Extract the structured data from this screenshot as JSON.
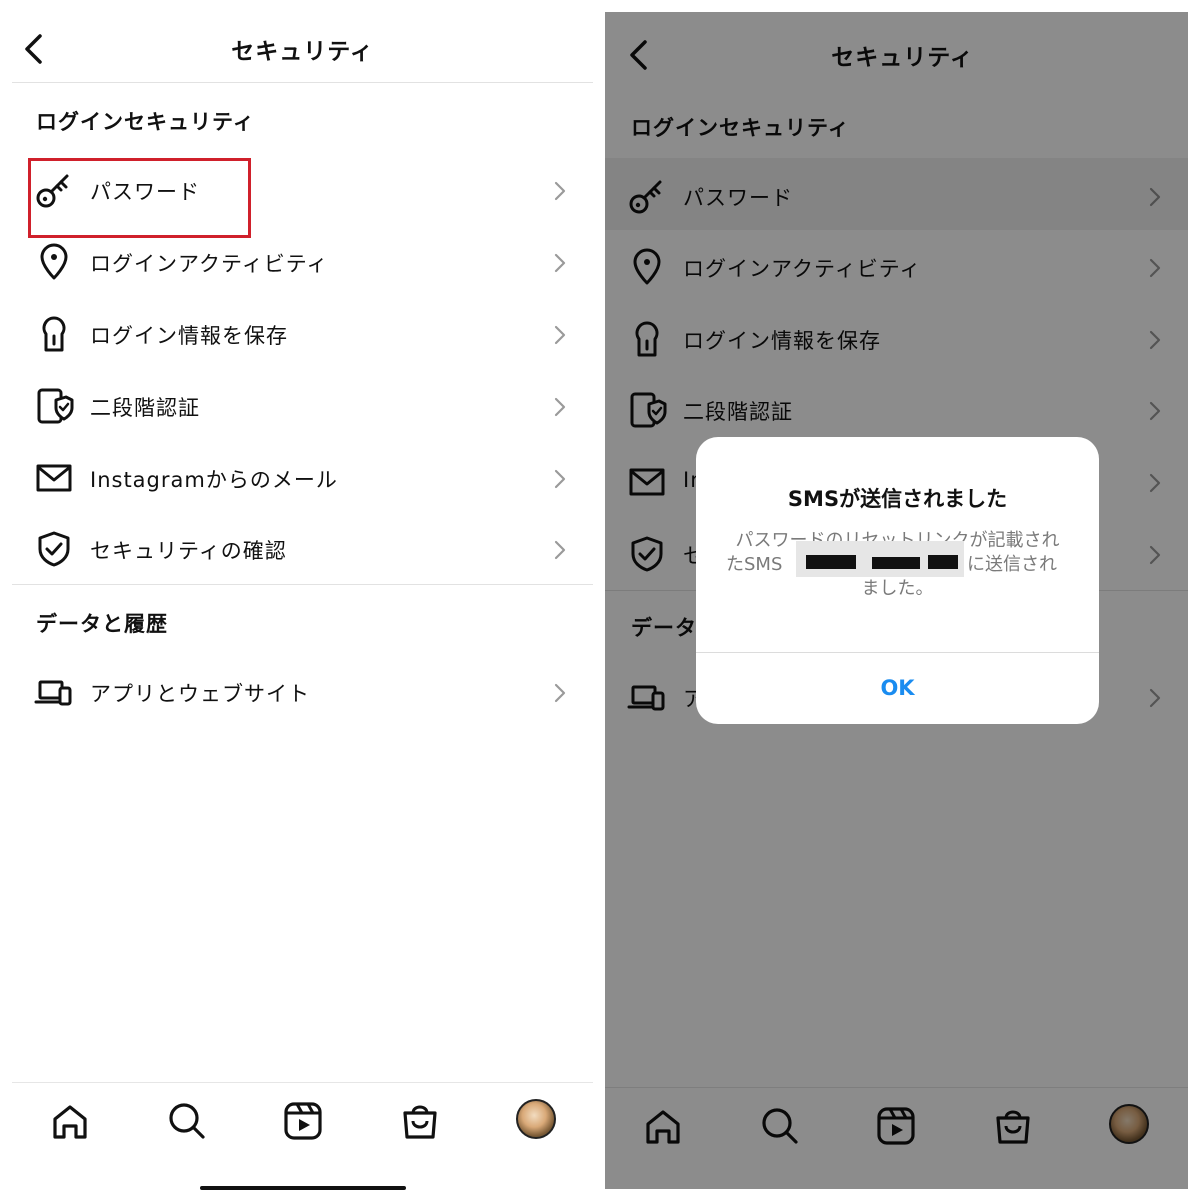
{
  "left": {
    "header": {
      "title": "セキュリティ"
    },
    "sections": [
      {
        "title": "ログインセキュリティ"
      },
      {
        "title": "データと履歴"
      }
    ],
    "rows": [
      {
        "label": "パスワード",
        "icon": "key-icon"
      },
      {
        "label": "ログインアクティビティ",
        "icon": "location-pin-icon"
      },
      {
        "label": "ログイン情報を保存",
        "icon": "keyhole-icon"
      },
      {
        "label": "二段階認証",
        "icon": "phone-shield-icon"
      },
      {
        "label": "Instagramからのメール",
        "icon": "mail-icon"
      },
      {
        "label": "セキュリティの確認",
        "icon": "shield-check-icon"
      },
      {
        "label": "アプリとウェブサイト",
        "icon": "devices-icon"
      }
    ],
    "highlight_color": "#d0202b"
  },
  "right": {
    "header": {
      "title": "セキュリティ"
    },
    "sections": [
      {
        "title": "ログインセキュリティ"
      },
      {
        "title": "データ"
      }
    ],
    "rows": [
      {
        "label": "パスワード"
      },
      {
        "label": "ログインアクティビティ"
      },
      {
        "label": "ログイン情報を保存"
      },
      {
        "label": "二段階認証"
      },
      {
        "label": "In"
      },
      {
        "label": "セ"
      },
      {
        "label": "ア"
      }
    ],
    "dialog": {
      "title": "SMSが送信されました",
      "body_line1": "パスワードのリセットリンクが記載され",
      "body_line2_prefix": "たSMS",
      "body_line2_suffix": "に送信され",
      "body_line3": "ました。",
      "ok_label": "OK",
      "ok_color": "#1a8cf0"
    }
  },
  "tabbar": {
    "items": [
      "home-icon",
      "search-icon",
      "reels-icon",
      "shop-icon",
      "profile-avatar"
    ]
  }
}
